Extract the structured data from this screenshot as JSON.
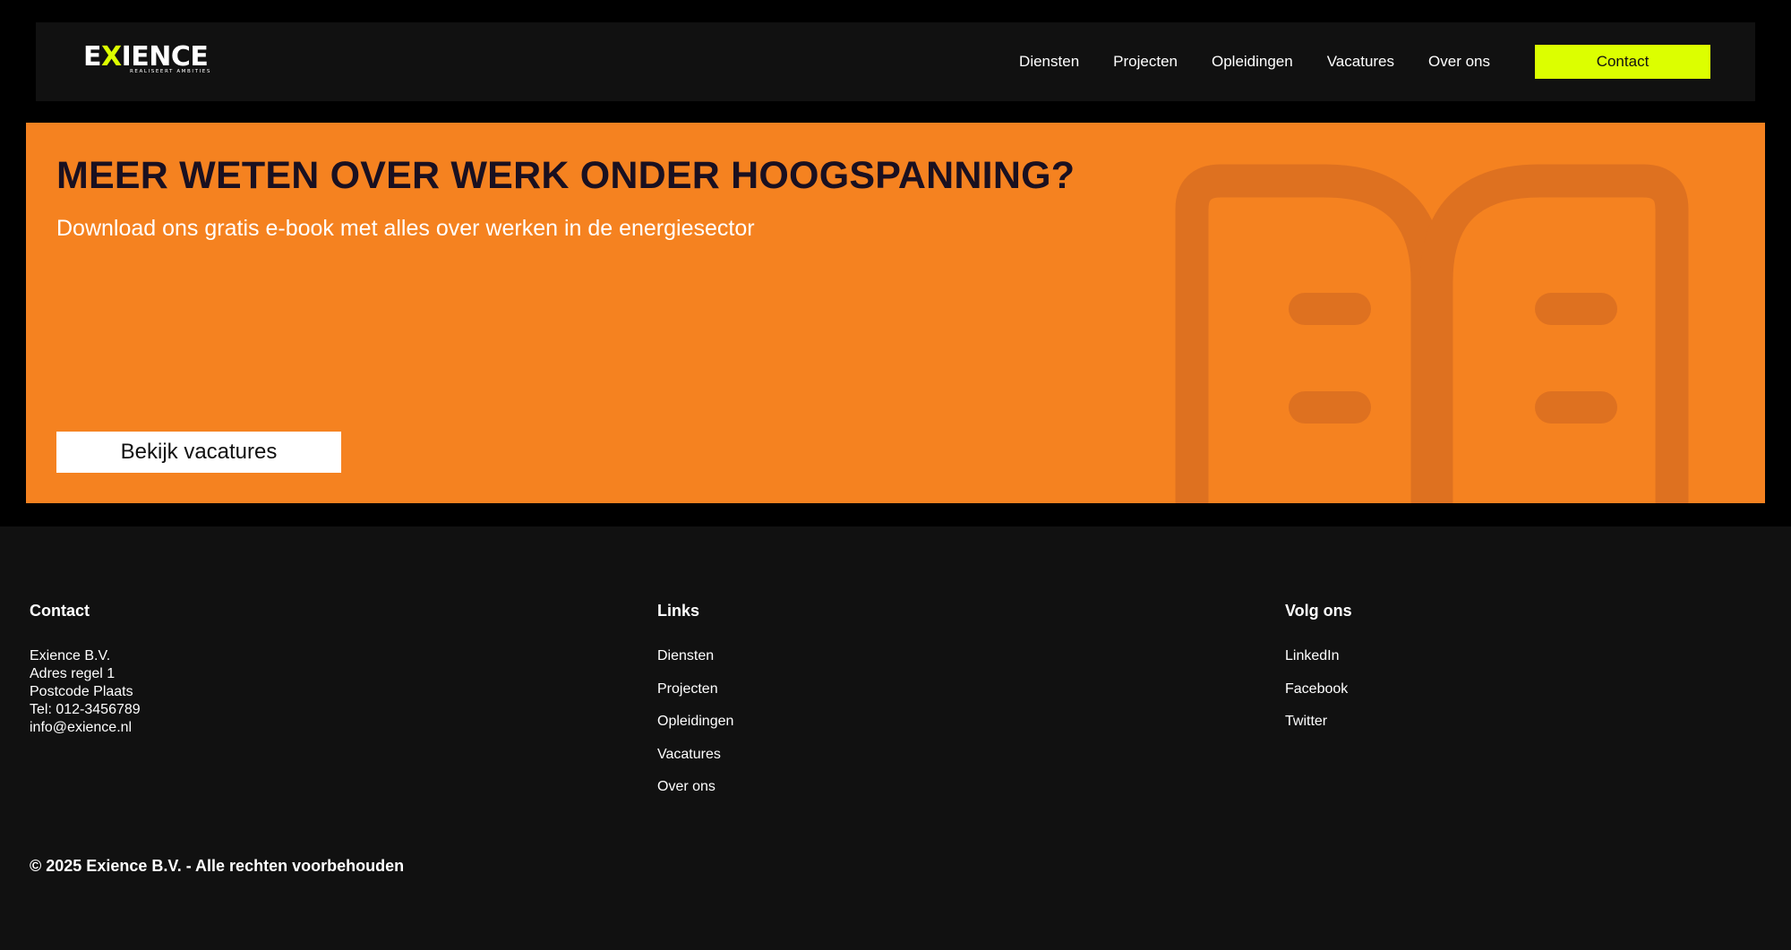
{
  "header": {
    "logo_word_start": "E",
    "logo_word_x": "X",
    "logo_word_end": "IENCE",
    "logo_tagline": "REALISEERT AMBITIES",
    "nav": [
      {
        "label": "Diensten"
      },
      {
        "label": "Projecten"
      },
      {
        "label": "Opleidingen"
      },
      {
        "label": "Vacatures"
      },
      {
        "label": "Over ons"
      }
    ],
    "contact_label": "Contact"
  },
  "banner": {
    "title": "MEER WETEN OVER WERK ONDER HOOGSPANNING?",
    "subtitle": "Download ons gratis e-book met alles over werken in de energiesector",
    "button_label": "Bekijk vacatures",
    "icon": "book-icon"
  },
  "footer": {
    "contact": {
      "heading": "Contact",
      "lines": [
        "Exience B.V.",
        "Adres regel 1",
        "Postcode Plaats",
        "Tel: 012-3456789",
        "info@exience.nl"
      ]
    },
    "links": {
      "heading": "Links",
      "items": [
        "Diensten",
        "Projecten",
        "Opleidingen",
        "Vacatures",
        "Over ons"
      ]
    },
    "social": {
      "heading": "Volg ons",
      "items": [
        "LinkedIn",
        "Facebook",
        "Twitter"
      ]
    },
    "copyright": "© 2025 Exience B.V. - Alle rechten voorbehouden"
  },
  "colors": {
    "page_bg": "#000000",
    "panel_bg": "#111111",
    "accent_lime": "#dcff00",
    "banner_orange": "#f58220",
    "icon_orange": "#de7120"
  }
}
